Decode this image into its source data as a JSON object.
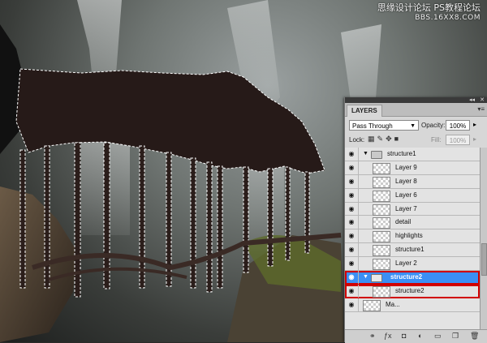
{
  "watermark": {
    "line1": "思缘设计论坛",
    "line2": "PS教程论坛",
    "line3": "BBS.16XX8.COM"
  },
  "panel": {
    "tab_label": "LAYERS",
    "blend_mode": "Pass Through",
    "opacity_label": "Opacity:",
    "opacity_value": "100%",
    "lock_label": "Lock:",
    "fill_label": "Fill:",
    "fill_value": "100%"
  },
  "layers": [
    {
      "name": "structure1"
    },
    {
      "name": "Layer 9"
    },
    {
      "name": "Layer 8"
    },
    {
      "name": "Layer 6"
    },
    {
      "name": "Layer 7"
    },
    {
      "name": "detail"
    },
    {
      "name": "highlights"
    },
    {
      "name": "structure1"
    },
    {
      "name": "Layer 2"
    },
    {
      "name": "structure2"
    },
    {
      "name": "structure2"
    },
    {
      "name": "Ma..."
    }
  ],
  "icons": {
    "eye": "eye-icon",
    "folder": "folder-icon",
    "expand": "triangle-expand-icon",
    "lock_transparent": "lock-transparency-icon",
    "lock_paint": "brush-icon",
    "lock_move": "move-icon",
    "lock_all": "lock-icon",
    "link": "link-icon",
    "fx": "fx-icon",
    "mask": "mask-icon",
    "adjust": "adjustment-icon",
    "group": "new-group-icon",
    "new_layer": "new-layer-icon",
    "trash": "trash-icon"
  },
  "colors": {
    "selected": "#3b8ff5",
    "highlight_box": "#d10000"
  }
}
